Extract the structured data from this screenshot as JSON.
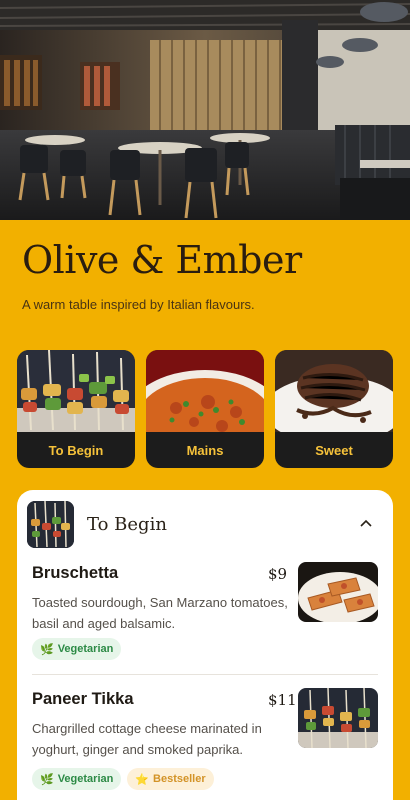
{
  "hero": {
    "icon": "restaurant-interior-photo"
  },
  "restaurant": {
    "name": "Olive & Ember",
    "tagline": "A warm table inspired by Italian flavours."
  },
  "categories": [
    {
      "label": "To Begin",
      "icon": "skewers-photo"
    },
    {
      "label": "Mains",
      "icon": "curry-photo"
    },
    {
      "label": "Sweet",
      "icon": "dessert-photo"
    }
  ],
  "section": {
    "title": "To Begin",
    "icon": "chevron-up-icon",
    "items": [
      {
        "name": "Bruschetta",
        "price": "$9",
        "description": "Toasted sourdough, San Marzano tomatoes, basil and aged balsamic.",
        "tags": [
          {
            "label": "Vegetarian",
            "icon": "leaf-icon"
          }
        ]
      },
      {
        "name": "Paneer Tikka",
        "price": "$11",
        "description": "Chargrilled cottage cheese marinated in yoghurt, ginger and smoked paprika.",
        "tags": [
          {
            "label": "Vegetarian",
            "icon": "leaf-icon"
          },
          {
            "label": "Bestseller",
            "icon": "star-icon"
          }
        ]
      }
    ]
  },
  "colors": {
    "background": "#f2b000",
    "card_dark": "#1c1c1c",
    "card_label": "#f6c23a",
    "veg_tag_bg": "#e6f5e9",
    "veg_tag_text": "#2c8a45",
    "best_tag_bg": "#fdf0d8",
    "best_tag_text": "#d39327"
  }
}
